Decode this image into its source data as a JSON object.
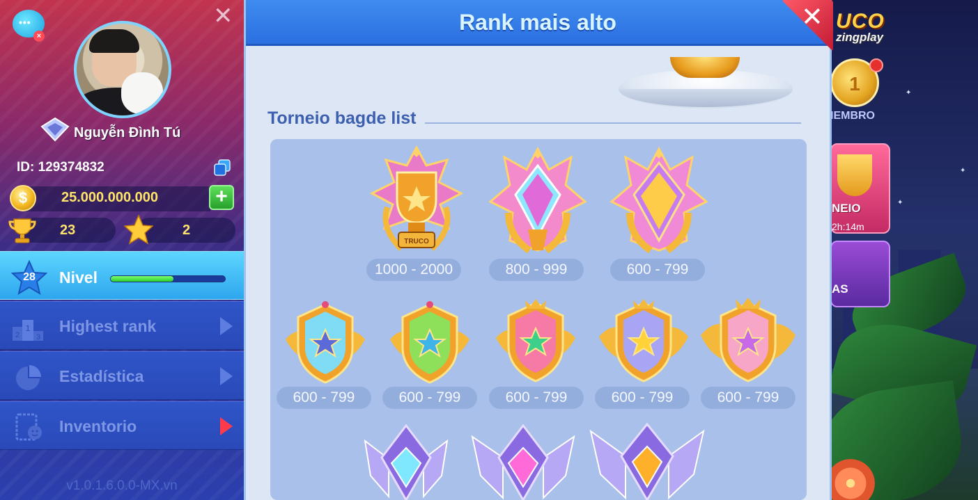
{
  "profile": {
    "name": "Nguyễn Đình Tú",
    "id_label": "ID: 129374832",
    "coins": "25.000.000.000",
    "trophies": "23",
    "stars": "2",
    "level": "28",
    "level_progress": 0.55
  },
  "menu": {
    "items": [
      {
        "label": "Nivel"
      },
      {
        "label": "Highest rank"
      },
      {
        "label": "Estadística"
      },
      {
        "label": "Inventorio"
      }
    ]
  },
  "version": "v1.0.1.6.0.0-MX.vn",
  "dialog": {
    "title": "Rank mais alto",
    "section_title": "Torneio bagde list",
    "rows": [
      {
        "ranges": [
          "1000 - 2000",
          "800 - 999",
          "600 - 799"
        ]
      },
      {
        "ranges": [
          "600 - 799",
          "600 - 799",
          "600 - 799",
          "600 - 799",
          "600 - 799"
        ]
      }
    ],
    "badge_text": "TRUCO"
  },
  "background": {
    "logo_line1": "UCO",
    "logo_line2": "zingplay",
    "medal_number": "1",
    "miembro": "IEMBRO",
    "torneo": "NEIO",
    "torneo_timer": "2h:14m",
    "mas": "AS"
  },
  "colors": {
    "accent": "#2f7ae8",
    "gold": "#ffe46a",
    "close_red": "#e02a40"
  }
}
